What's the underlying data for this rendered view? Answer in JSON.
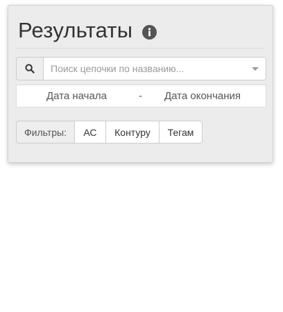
{
  "panel": {
    "title": "Результаты",
    "info_icon": "info-circle-icon"
  },
  "search": {
    "icon": "search-icon",
    "placeholder": "Поиск цепочки по названию...",
    "value": "",
    "dropdown_icon": "caret-down-icon"
  },
  "dates": {
    "start_label": "Дата начала",
    "separator": "-",
    "end_label": "Дата окончания"
  },
  "filters": {
    "label": "Фильтры:",
    "buttons": [
      {
        "label": "АС"
      },
      {
        "label": "Контуру"
      },
      {
        "label": "Тегам"
      }
    ]
  }
}
